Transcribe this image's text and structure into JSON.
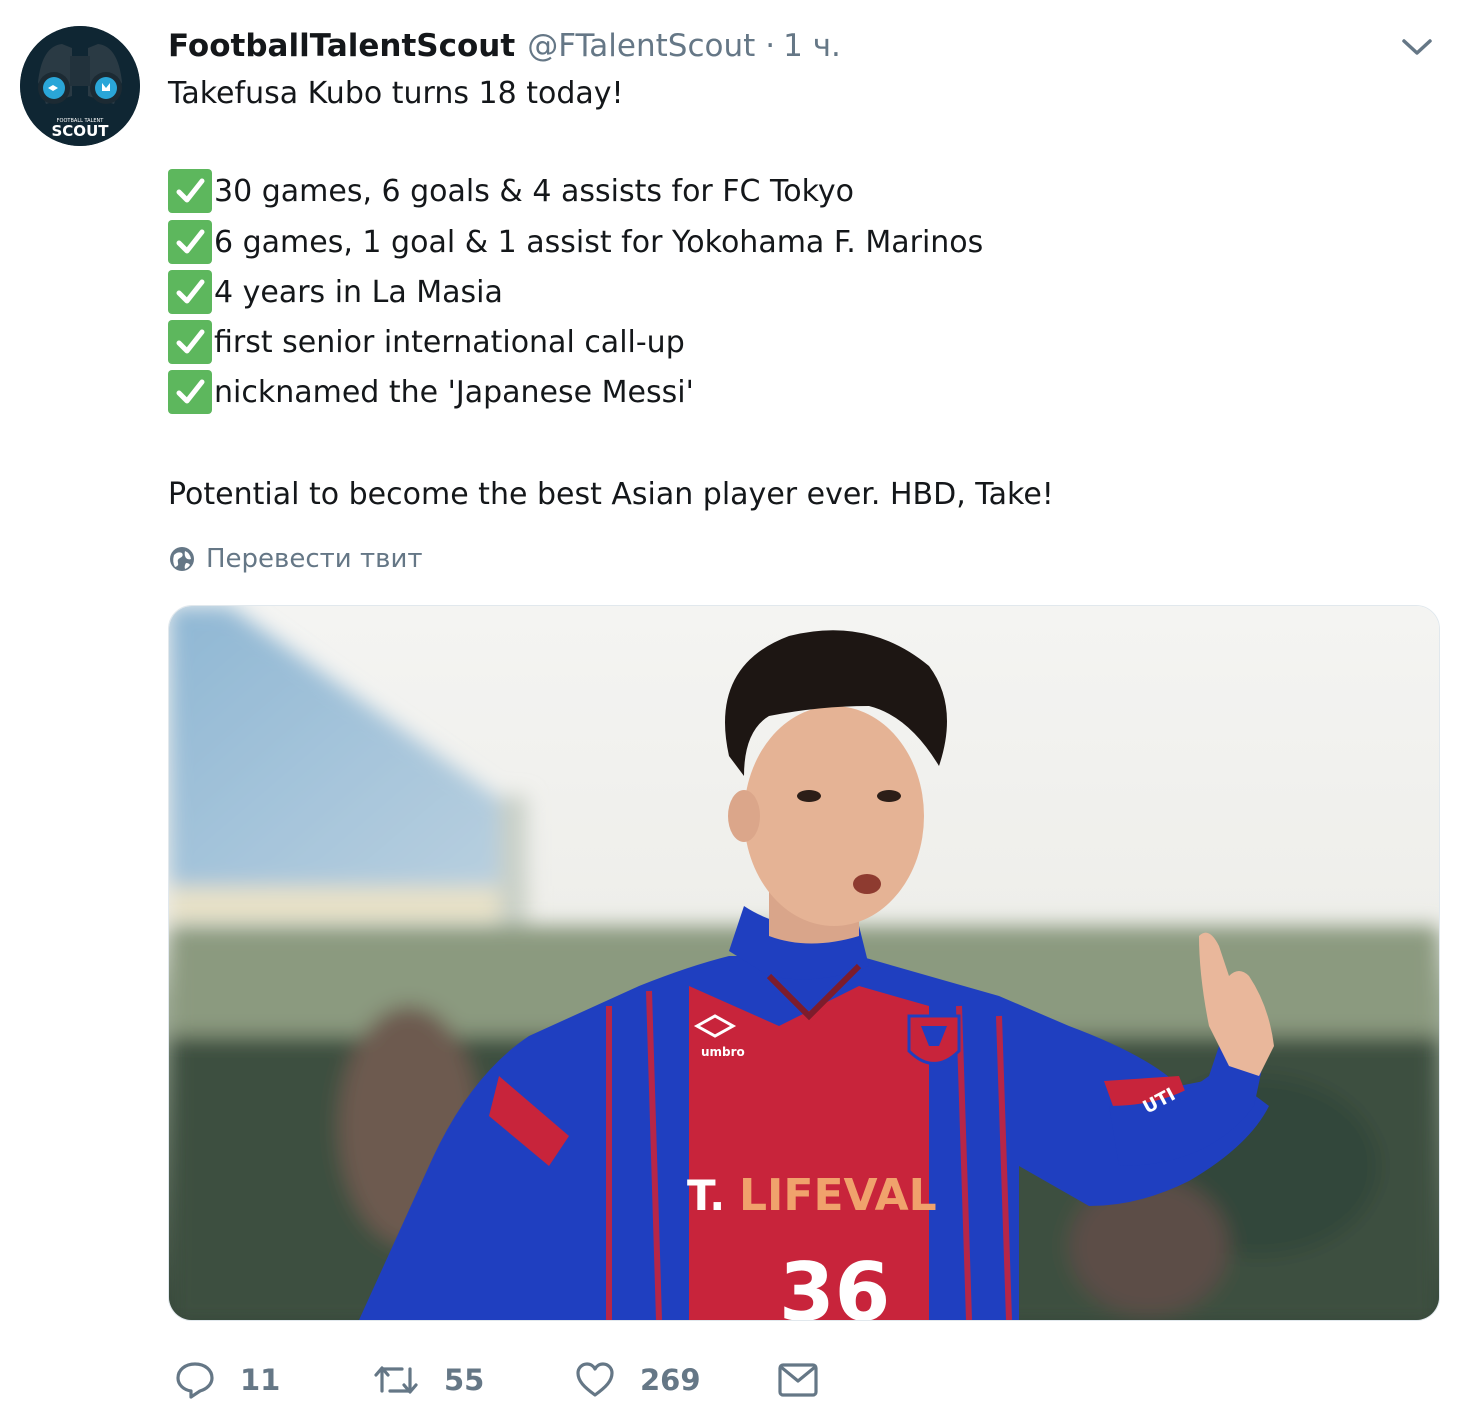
{
  "tweet": {
    "display_name": "FootballTalentScout",
    "handle": "@FTalentScout",
    "separator": "·",
    "time": "1 ч.",
    "avatar": {
      "lines": [
        "FOOTBALL TALENT",
        "SCOUT"
      ]
    },
    "text_intro": "Takefusa Kubo turns 18 today!",
    "checklist": [
      "30 games, 6 goals & 4 assists for FC Tokyo",
      "6 games, 1 goal & 1 assist for Yokohama F. Marinos",
      "4 years in La Masia",
      "first senior international call-up",
      "nicknamed the 'Japanese Messi'"
    ],
    "text_outro": "Potential to become the best Asian player ever. HBD, Take!",
    "translate_label": "Перевести твит",
    "photo": {
      "jersey_sponsor": "LIFEVAL",
      "sponsor_prefix": "T.",
      "kit_brand": "umbro",
      "jersey_number": "36",
      "sleeve_text": "UTI"
    },
    "actions": {
      "replies": "11",
      "retweets": "55",
      "likes": "269"
    }
  },
  "colors": {
    "check_green": "#5db75d",
    "secondary_text": "#657786",
    "jersey_blue": "#1f3fc0",
    "jersey_red": "#c8243b"
  }
}
